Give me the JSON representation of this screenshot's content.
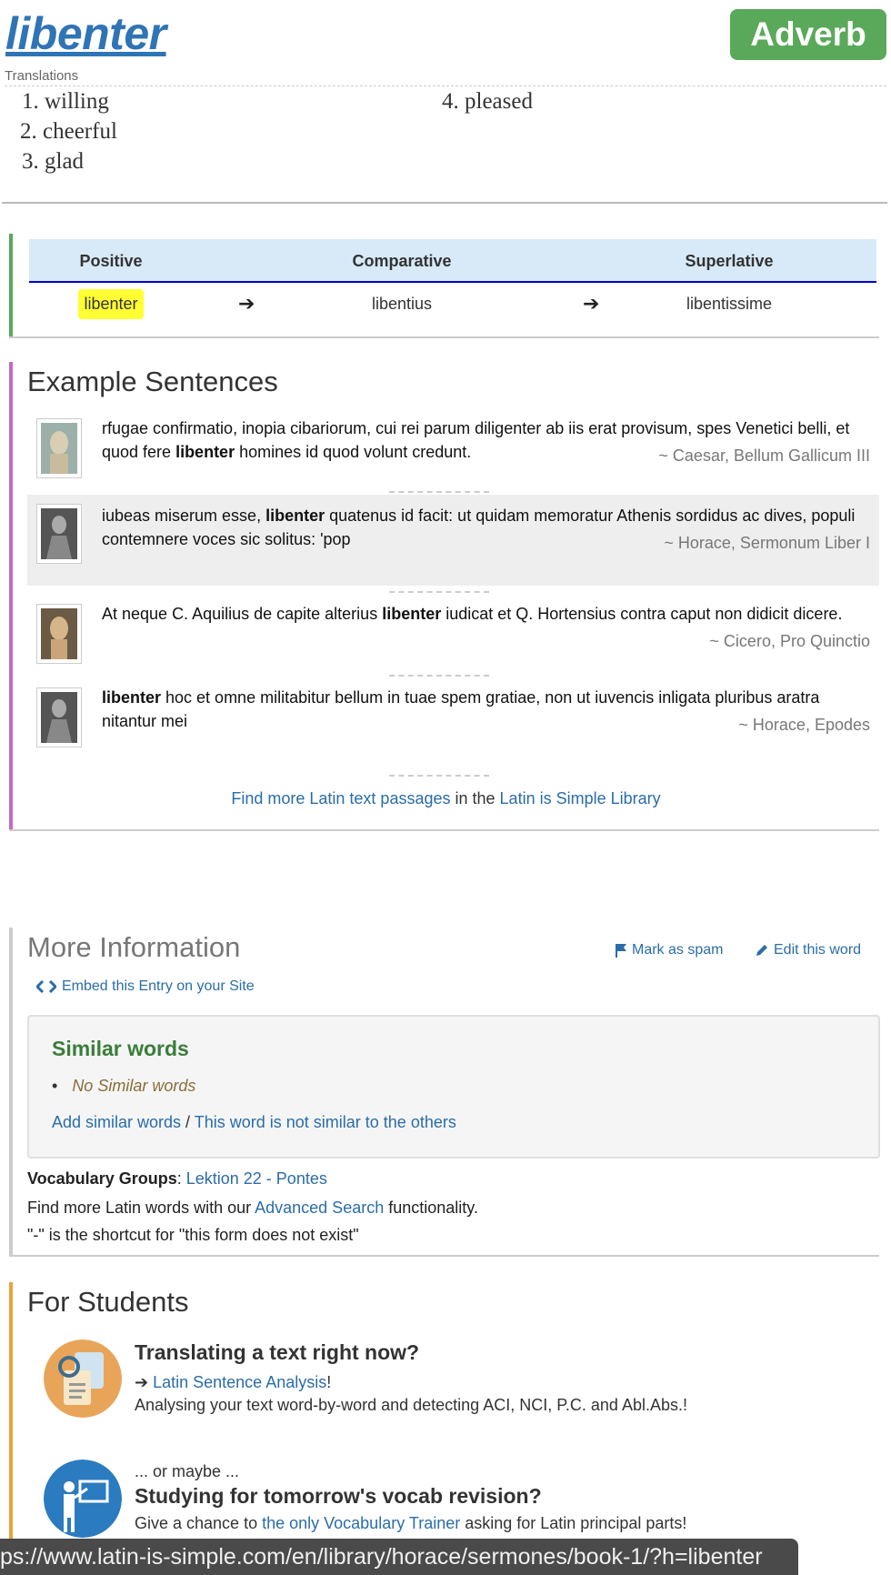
{
  "word": {
    "title": "libenter",
    "part_of_speech": "Adverb",
    "translations_label": "Translations",
    "translations": [
      "1. willing",
      "2. cheerful",
      "3. glad",
      "4. pleased"
    ]
  },
  "comparison": {
    "headers": [
      "Positive",
      "Comparative",
      "Superlative"
    ],
    "values": [
      "libenter",
      "libentius",
      "libentissime"
    ],
    "highlight_color": "#ffff33",
    "accent_color": "#5aa95a"
  },
  "examples": {
    "title": "Example Sentences",
    "accent_color": "#c36ac8",
    "sentences": [
      {
        "pre": "rfugae confirmatio, inopia cibariorum, cui rei parum diligenter ab iis erat provisum, spes Venetici belli, et quod fere ",
        "bold": "libenter",
        "post": " homines id quod volunt credunt.",
        "source": "~ Caesar, Bellum Gallicum III",
        "portrait": "caesar-bust-icon"
      },
      {
        "pre": "iubeas miserum esse, ",
        "bold": "libenter",
        "post": " quatenus id facit: ut quidam memoratur Athenis sordidus ac dives, populi contemnere voces sic solitus: 'pop",
        "source": "~ Horace, Sermonum Liber I",
        "portrait": "horace-portrait-icon"
      },
      {
        "pre": "At neque C. Aquilius de capite alterius ",
        "bold": "libenter",
        "post": " iudicat et Q. Hortensius contra caput non didicit dicere.",
        "source": "~ Cicero, Pro Quinctio",
        "portrait": "cicero-bust-icon"
      },
      {
        "pre": "",
        "bold": "libenter",
        "post": " hoc et omne militabitur bellum in tuae spem gratiae, non ut iuvencis inligata pluribus aratra nitantur mei",
        "source": "~ Horace, Epodes",
        "portrait": "horace-portrait-icon"
      }
    ],
    "find_more": {
      "link1": "Find more Latin text passages",
      "middle": " in the ",
      "link2": "Latin is Simple Library"
    }
  },
  "more_info": {
    "title": "More Information",
    "mark_spam": "Mark as spam",
    "edit_word": "Edit this word",
    "embed": "Embed this Entry on your Site",
    "similar": {
      "title": "Similar words",
      "none": "No Similar words",
      "add_link": "Add similar words",
      "slash": " / ",
      "not_similar_link": "This word is not similar to the others"
    },
    "vocab_label": "Vocabulary Groups",
    "vocab_colon": ": ",
    "vocab_group": "Lektion 22 - Pontes",
    "search_pre": "Find more Latin words with our ",
    "search_link": "Advanced Search",
    "search_post": " functionality.",
    "shortcut_note": "\"-\" is the shortcut for \"this form does not exist\""
  },
  "students": {
    "title": "For Students",
    "accent_color": "#e8a23c",
    "block1": {
      "heading": "Translating a text right now?",
      "link": "Latin Sentence Analysis",
      "excl": "!",
      "desc": "Analysing your text word-by-word and detecting ACI, NCI, P.C. and Abl.Abs.!"
    },
    "block2": {
      "pre": "... or maybe ...",
      "heading": "Studying for tomorrow's vocab revision?",
      "desc_pre": "Give a chance to ",
      "link": "the only Vocabulary Trainer",
      "desc_post": " asking for Latin principal parts!"
    }
  },
  "status_bar": {
    "url": "ps://www.latin-is-simple.com/en/library/horace/sermones/book-1/?h=libenter"
  }
}
